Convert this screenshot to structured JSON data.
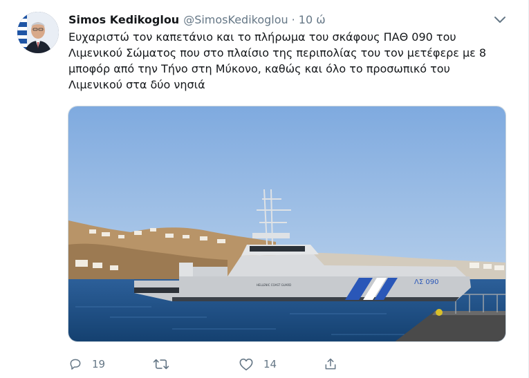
{
  "tweet": {
    "author_name": "Simos Kedikoglou",
    "author_handle": "@SimosKedikoglou",
    "separator": "·",
    "time": "10 ώ",
    "text": "Ευχαριστώ τον καπετάνιο και το πλήρωμα του σκάφους ΠΑΘ 090 του\nΛιμενικού Σώματος που στο πλαίσιο της περιπολίας του τον μετέφερε με 8\nμποφόρ από την Τήνο στη Μύκονο, καθώς και όλο το προσωπικό του\nΛιμενικού στα δύο νησιά",
    "media": {
      "hull_label": "ΛΣ 090",
      "side_label": "HELLENIC COAST GUARD"
    }
  },
  "actions": {
    "reply_icon": "reply-icon",
    "reply_count": "19",
    "retweet_icon": "retweet-icon",
    "like_icon": "heart-icon",
    "like_count": "14",
    "share_icon": "share-icon"
  },
  "colors": {
    "text_primary": "#14171a",
    "text_secondary": "#657786",
    "sky": "#8fb6e4",
    "sea": "#1e4f8a",
    "boat_hull": "#c9ccd1",
    "boat_stripe": "#2a57b8"
  }
}
